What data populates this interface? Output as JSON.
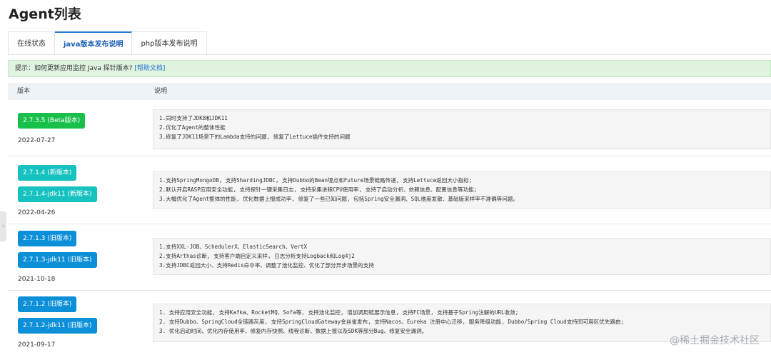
{
  "page_title": "Agent列表",
  "tabs": [
    {
      "label": "在线状态",
      "active": false
    },
    {
      "label": "java版本发布说明",
      "active": true
    },
    {
      "label": "php版本发布说明",
      "active": false
    }
  ],
  "tip": {
    "text": "提示：如何更新应用监控 Java 探针版本?",
    "link": "[帮助文档]"
  },
  "table": {
    "headers": [
      "版本",
      "说明"
    ],
    "rows": [
      {
        "badges": [
          {
            "label": "2.7.3.5 (Beta版本)",
            "color": "#18c04a"
          }
        ],
        "date": "2022-07-27",
        "lines": [
          "1.同时支持了JDK8和JDK11",
          "2.优化了Agent的整体性能",
          "3.修复了JDK11场景下的Lambda支持的问题, 修复了Lettuce插件支持的问题"
        ]
      },
      {
        "badges": [
          {
            "label": "2.7.1.4 (新版本)",
            "color": "#15c2c0"
          },
          {
            "label": "2.7.1.4-jdk11 (新版本)",
            "color": "#15c2c0"
          }
        ],
        "date": "2022-04-26",
        "lines": [
          "1.支持SpringMongoDB, 支持ShardingJDBC, 支持Dubbo的Bean埋点和Future场景链路传递, 支持Lettuce返回大小指标;",
          "2.默认开启RASP应用安全功能, 支持探针一键采集日志, 支持采集进程CPU使用率, 支持了启动分析、依赖信息、配置信息等功能;",
          "3.大幅优化了Agent整体的性能, 优化数据上报成功率, 修复了一些已知问题, 包括Spring安全漏洞、SQL维度发散、基础版采样率不准确等问题。"
        ]
      },
      {
        "badges": [
          {
            "label": "2.7.1.3 (旧版本)",
            "color": "#0b8fd8"
          },
          {
            "label": "2.7.1.3-jdk11 (旧版本)",
            "color": "#0b8fd8"
          }
        ],
        "date": "2021-10-18",
        "lines": [
          "1.支持XXL-JOB、SchedulerX、ElasticSearch、VertX",
          "2.支持Arthas诊断, 支持客户端自定义采样, 日志分析支持Logback和Log4j2",
          "3.支持JDBC返回大小、支持Redis命中率、调整了池化监控、优化了部分异步场景的支持"
        ]
      },
      {
        "badges": [
          {
            "label": "2.7.1.2 (旧版本)",
            "color": "#0b8fd8"
          },
          {
            "label": "2.7.1.2-jdk11 (旧版本)",
            "color": "#0b8fd8"
          }
        ],
        "date": "2021-09-17",
        "lines": [
          "1. 支持应用安全功能, 支持Kafka、RocketMQ、Sofa等, 支持池化监控, 增加调用链展示信息, 支持FC场景, 支持基于Spring注解的URL收敛;",
          "2. 支持Dubbo、SpringCloud全链路灰度, 支持SpringCloudGateway金丝雀发布, 支持Nacos、Eureka 注册中心迁移, 服务降级功能, Dubbo/Spring Cloud支持同可用区优先路由;",
          "3. 优化启动时间、优化内存使用率、修复内存快照、线程诊断、数据上报以及SDK等部分Bug、修复安全漏洞。"
        ]
      }
    ]
  },
  "watermark": "@稀土掘金技术社区"
}
